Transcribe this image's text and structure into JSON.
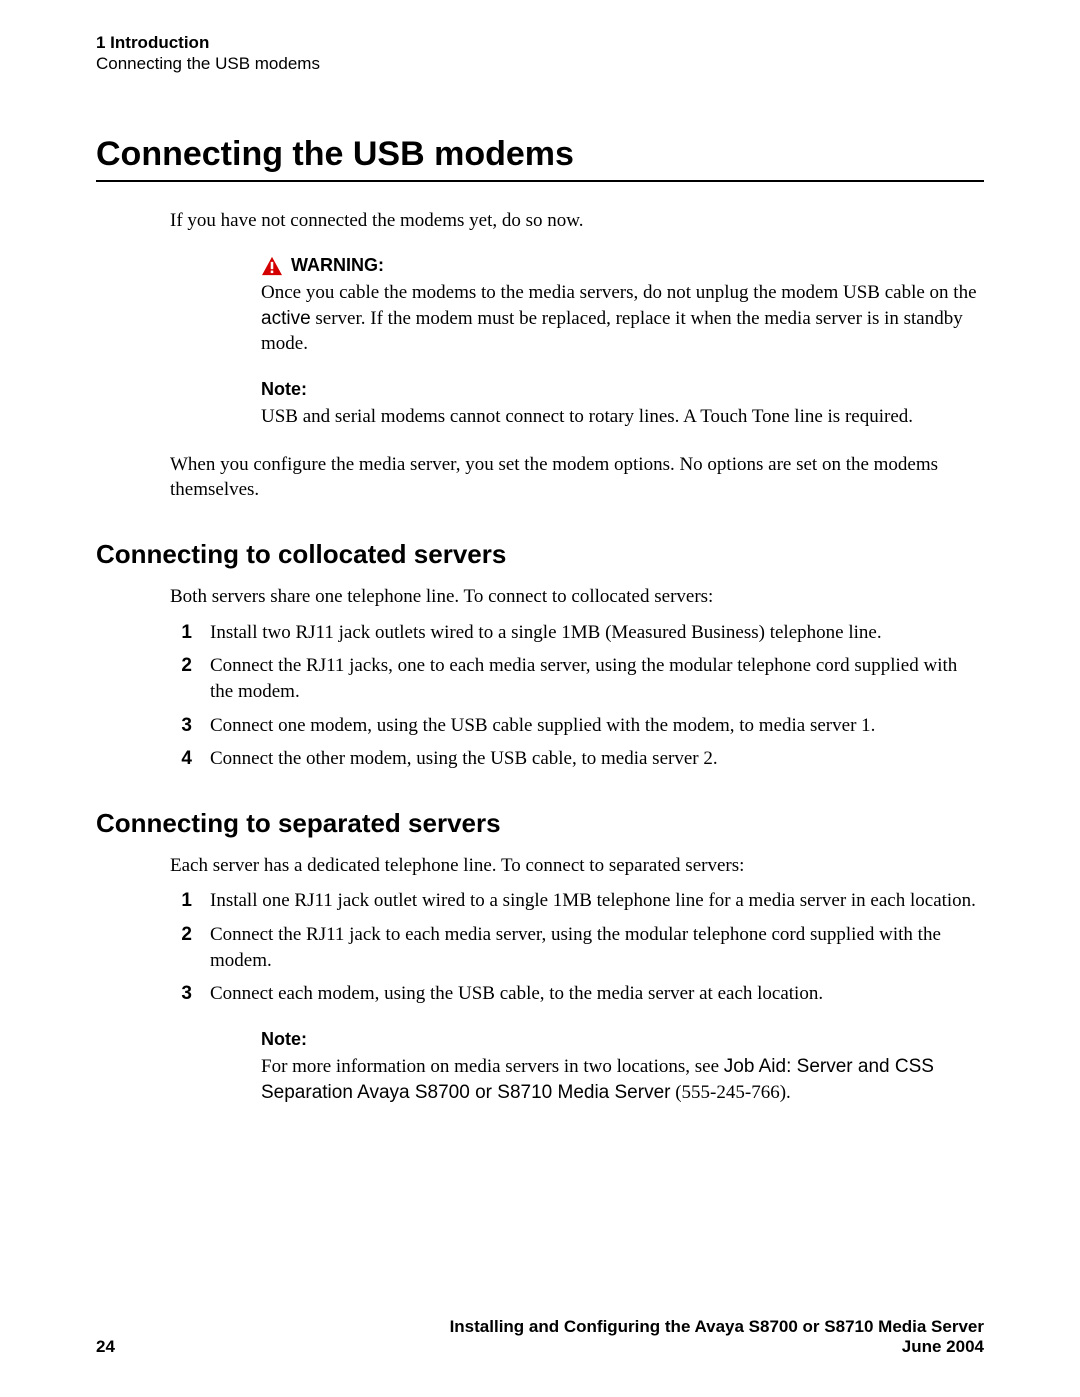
{
  "header": {
    "chapter": "1  Introduction",
    "section": "Connecting the USB modems"
  },
  "title": "Connecting the USB modems",
  "intro": "If you have not connected the modems yet, do so now.",
  "warning": {
    "label": "WARNING:",
    "body_pre": "Once you cable the modems to the media servers, do not unplug the modem USB cable on the ",
    "body_active": "active",
    "body_post": " server. If the modem must be replaced, replace it when the media server is in standby mode."
  },
  "note1": {
    "label": "Note:",
    "body": "USB and serial modems cannot connect to rotary lines. A Touch Tone line is required."
  },
  "after": "When you configure the media server, you set the modem options. No options are set on the modems themselves.",
  "sec1": {
    "title": "Connecting to collocated servers",
    "lead": "Both servers share one telephone line. To connect to collocated servers:",
    "steps": [
      "Install two RJ11 jack outlets wired to a single 1MB (Measured Business) telephone line.",
      "Connect the RJ11 jacks, one to each media server, using the modular telephone cord supplied with the modem.",
      "Connect one modem, using the USB cable supplied with the modem, to media server 1.",
      "Connect the other modem, using the USB cable, to media server 2."
    ]
  },
  "sec2": {
    "title": "Connecting to separated servers",
    "lead": "Each server has a dedicated telephone line. To connect to separated servers:",
    "steps": [
      "Install one RJ11 jack outlet wired to a single 1MB telephone line for a media server in each location.",
      "Connect the RJ11 jack to each media server, using the modular telephone cord supplied with the modem.",
      "Connect each modem, using the USB cable, to the media server at each location."
    ]
  },
  "note2": {
    "label": "Note:",
    "body_pre": "For more information on media servers in two locations, see ",
    "body_ref": "Job Aid: Server and CSS Separation Avaya S8700 or S8710 Media Server",
    "body_post": " (555-245-766)."
  },
  "footer": {
    "page": "24",
    "title": "Installing and Configuring the Avaya S8700 or S8710 Media Server",
    "date": "June 2004"
  }
}
